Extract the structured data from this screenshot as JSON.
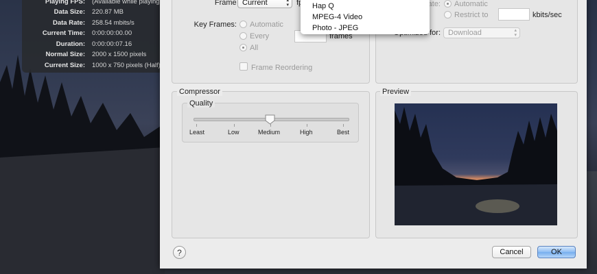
{
  "inspector": {
    "rows": [
      {
        "label": "Playing FPS:",
        "value": "(Available while playing)"
      },
      {
        "label": "Data Size:",
        "value": "220.87 MB"
      },
      {
        "label": "Data Rate:",
        "value": "258.54 mbits/s"
      },
      {
        "label": "Current Time:",
        "value": "0:00:00:00.00"
      },
      {
        "label": "Duration:",
        "value": "0:00:00:07.16"
      },
      {
        "label": "Normal Size:",
        "value": "2000 x 1500 pixels"
      },
      {
        "label": "Current Size:",
        "value": "1000 x 750 pixels (Half)"
      }
    ]
  },
  "video_settings": {
    "frame_rate_label": "Frame Rate:",
    "frame_rate_value": "Current",
    "fps_unit": "fps",
    "key_frames_label": "Key Frames:",
    "kf_automatic": "Automatic",
    "kf_every": "Every",
    "kf_all": "All",
    "frames_unit": "frames",
    "frame_reordering": "Frame Reordering"
  },
  "data_rate": {
    "label": "Data Rate:",
    "automatic": "Automatic",
    "restrict_to": "Restrict to",
    "unit": "kbits/sec",
    "optimized_for_label": "Optimized for:",
    "optimized_for_value": "Download"
  },
  "codec_menu": {
    "items": [
      "Hap Q",
      "MPEG-4 Video",
      "Photo - JPEG"
    ]
  },
  "compressor": {
    "title": "Compressor",
    "quality_title": "Quality",
    "quality_levels": [
      "Least",
      "Low",
      "Medium",
      "High",
      "Best"
    ],
    "quality_selected": "Medium"
  },
  "preview": {
    "title": "Preview"
  },
  "buttons": {
    "help": "?",
    "cancel": "Cancel",
    "ok": "OK"
  },
  "colors": {
    "default_button": "#76aeee",
    "sheet_background": "#ececec"
  }
}
